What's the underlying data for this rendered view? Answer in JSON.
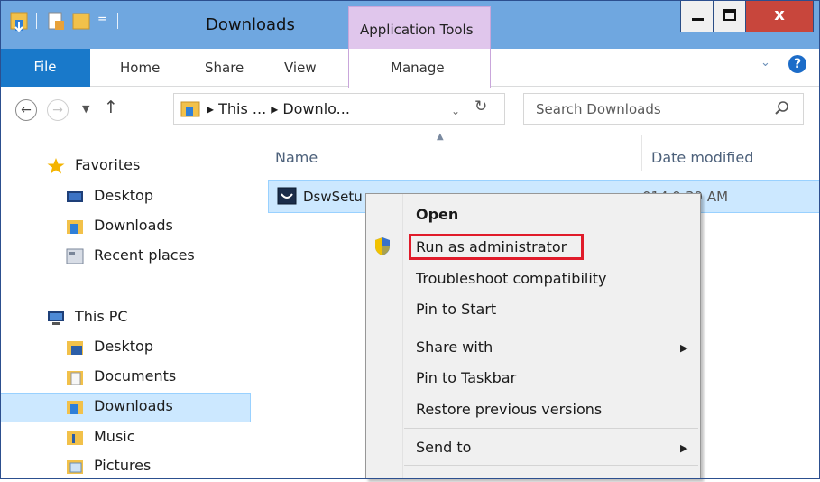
{
  "window": {
    "title": "Downloads",
    "contextual_tab_group": "Application Tools",
    "controls": {
      "minimize_icon": "minimize-icon",
      "maximize_icon": "maximize-icon",
      "close_glyph": "x"
    }
  },
  "ribbon": {
    "tabs": [
      "File",
      "Home",
      "Share",
      "View",
      "Manage"
    ],
    "help_glyph": "?"
  },
  "address": {
    "path_text": "▸ This ... ▸ Downlo...",
    "search_placeholder": "Search Downloads"
  },
  "nav_pane": {
    "favorites": {
      "label": "Favorites",
      "items": [
        "Desktop",
        "Downloads",
        "Recent places"
      ]
    },
    "this_pc": {
      "label": "This PC",
      "items": [
        "Desktop",
        "Documents",
        "Downloads",
        "Music",
        "Pictures"
      ],
      "selected": "Downloads"
    }
  },
  "file_list": {
    "columns": [
      "Name",
      "Date modified"
    ],
    "rows": [
      {
        "name": "DswSetu",
        "date": "014 9:39 AM"
      }
    ]
  },
  "context_menu": {
    "items": [
      {
        "label": "Open",
        "bold": true
      },
      {
        "label": "Run as administrator",
        "icon": "uac-shield-icon",
        "highlighted": true
      },
      {
        "label": "Troubleshoot compatibility"
      },
      {
        "label": "Pin to Start"
      },
      {
        "label": "Share with",
        "submenu": true
      },
      {
        "label": "Pin to Taskbar"
      },
      {
        "label": "Restore previous versions"
      },
      {
        "label": "Send to",
        "submenu": true
      }
    ]
  },
  "colors": {
    "titlebar": "#6fa7e0",
    "file_tab": "#1979ca",
    "contextual_tab": "#e0c6ec",
    "selection": "#cce8ff",
    "highlight_box": "#e01b2a",
    "close_button": "#c8463c"
  }
}
